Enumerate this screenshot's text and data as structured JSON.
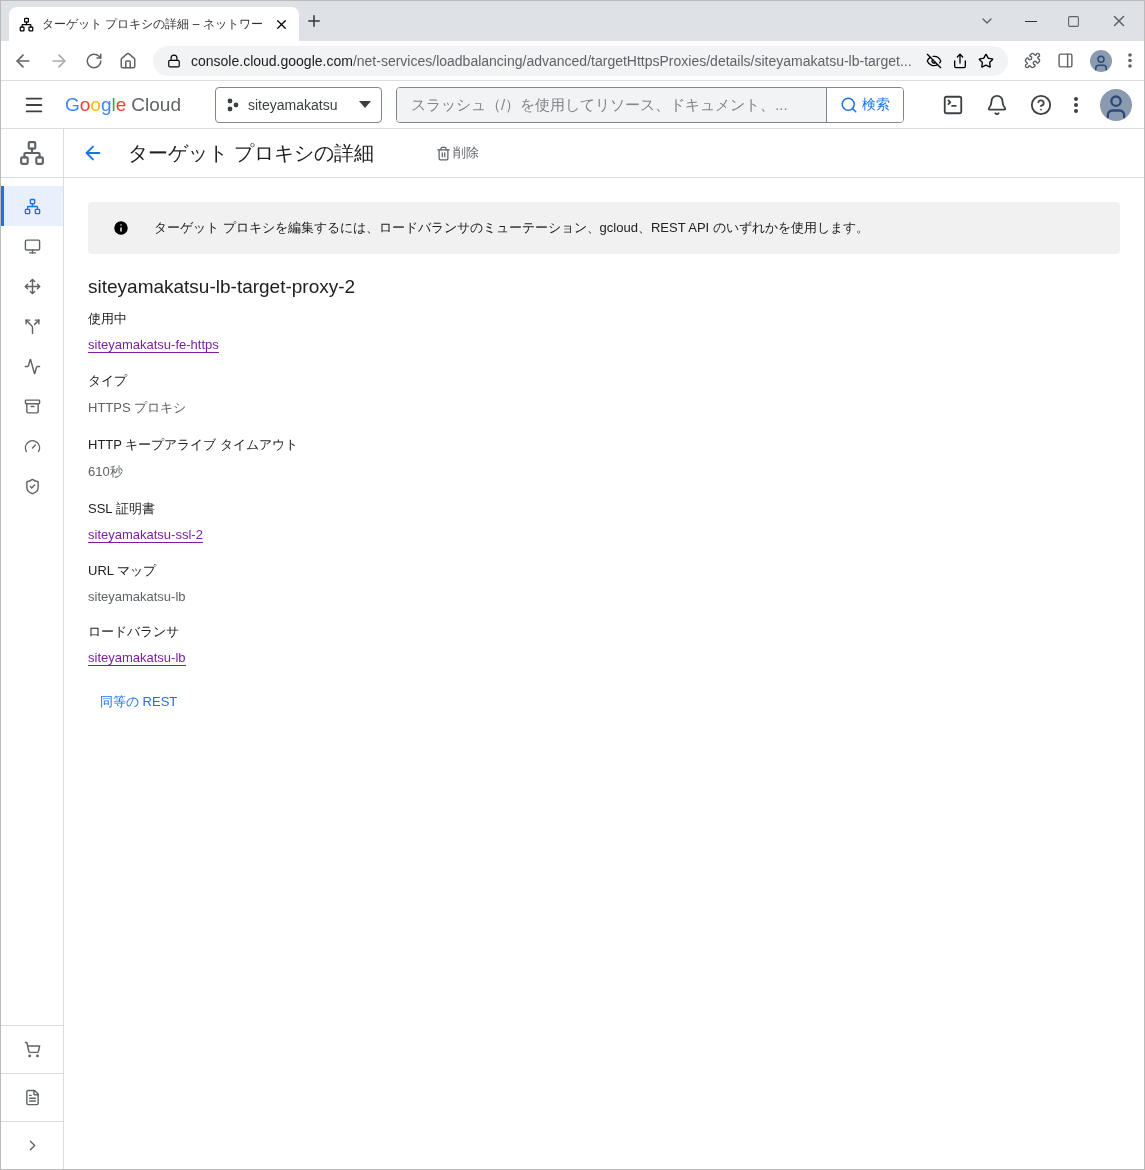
{
  "browser": {
    "tab_title": "ターゲット プロキシの詳細 – ネットワー",
    "url_host": "console.cloud.google.com",
    "url_path": "/net-services/loadbalancing/advanced/targetHttpsProxies/details/siteyamakatsu-lb-target..."
  },
  "header": {
    "logo_brand": "Google",
    "logo_product": "Cloud",
    "project": "siteyamakatsu",
    "search_placeholder": "スラッシュ（/）を使用してリソース、ドキュメント、...",
    "search_button": "検索"
  },
  "rail": {
    "items": [
      {
        "kind": "network",
        "selected": true
      },
      {
        "kind": "monitor",
        "selected": false
      },
      {
        "kind": "move",
        "selected": false
      },
      {
        "kind": "route",
        "selected": false
      },
      {
        "kind": "pulse",
        "selected": false
      },
      {
        "kind": "archive",
        "selected": false
      },
      {
        "kind": "speed",
        "selected": false
      },
      {
        "kind": "shield",
        "selected": false
      }
    ],
    "bottom_items": [
      {
        "kind": "cart"
      },
      {
        "kind": "notes"
      },
      {
        "kind": "expand"
      }
    ]
  },
  "page": {
    "title": "ターゲット プロキシの詳細",
    "delete_button": "削除",
    "notice": "ターゲット プロキシを編集するには、ロードバランサのミューテーション、gcloud、REST API のいずれかを使用します。",
    "name": "siteyamakatsu-lb-target-proxy-2",
    "fields": [
      {
        "label": "使用中",
        "value": "siteyamakatsu-fe-https",
        "kind": "link"
      },
      {
        "label": "タイプ",
        "value": "HTTPS プロキシ",
        "kind": "text"
      },
      {
        "label": "HTTP キープアライブ タイムアウト",
        "value": "610秒",
        "kind": "text"
      },
      {
        "label": "SSL 証明書",
        "value": "siteyamakatsu-ssl-2",
        "kind": "link"
      },
      {
        "label": "URL マップ",
        "value": "siteyamakatsu-lb",
        "kind": "text"
      },
      {
        "label": "ロードバランサ",
        "value": "siteyamakatsu-lb",
        "kind": "link"
      }
    ],
    "rest_link": "同等の REST"
  }
}
